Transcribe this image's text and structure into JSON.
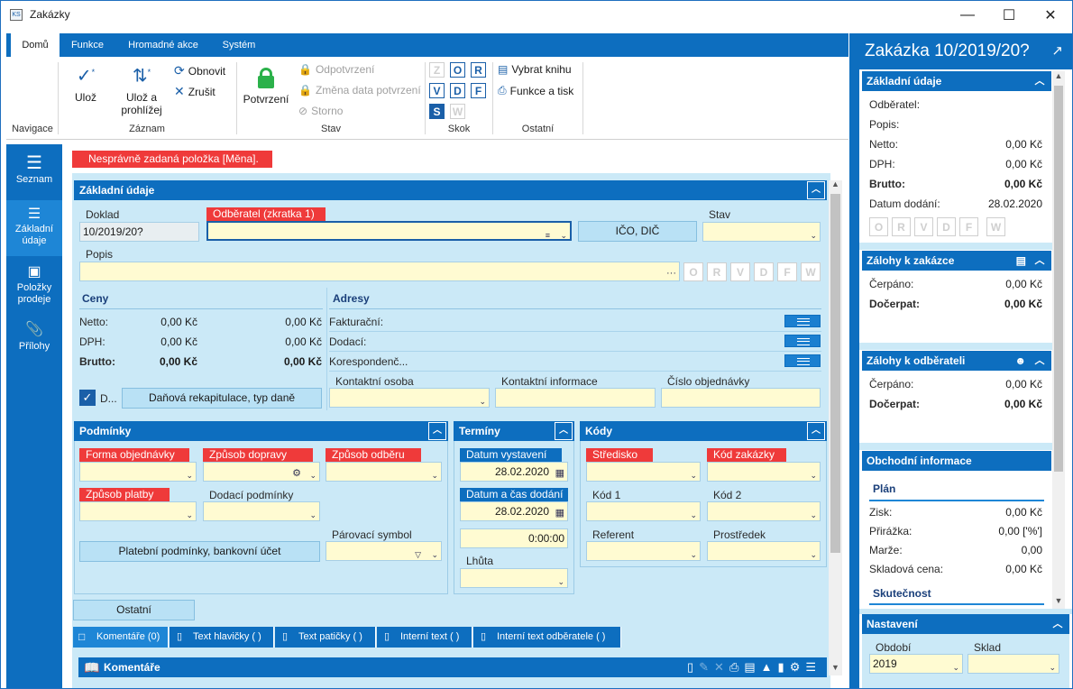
{
  "window": {
    "title": "Zakázky"
  },
  "ribbon": {
    "tabs": [
      {
        "label": "Domů"
      },
      {
        "label": "Funkce"
      },
      {
        "label": "Hromadné akce"
      },
      {
        "label": "Systém"
      }
    ],
    "groups": {
      "nav": "Navigace",
      "record": "Záznam",
      "state": "Stav",
      "jump": "Skok",
      "other": "Ostatní"
    },
    "save": "Ulož",
    "save_browse_1": "Ulož a",
    "save_browse_2": "prohlížej",
    "refresh": "Obnovit",
    "cancel": "Zrušit",
    "confirm": "Potvrzení",
    "unconfirm": "Odpotvrzení",
    "change_date": "Změna data potvrzení",
    "storno": "Storno",
    "jump_letters": [
      "Z",
      "O",
      "R",
      "V",
      "D",
      "F",
      "S",
      "W"
    ],
    "pick_book": "Vybrat knihu",
    "func_print": "Funkce a tisk"
  },
  "leftnav": {
    "items": [
      {
        "label": "Seznam"
      },
      {
        "label1": "Základní",
        "label2": "údaje"
      },
      {
        "label1": "Položky",
        "label2": "prodeje"
      },
      {
        "label": "Přílohy"
      }
    ]
  },
  "error": "Nesprávně zadaná položka [Měna].",
  "basic": {
    "title": "Základní údaje",
    "doklad_label": "Doklad",
    "doklad_value": "10/2019/20?",
    "customer_label": "Odběratel (zkratka 1)",
    "ico_button": "IČO, DIČ",
    "stav_label": "Stav",
    "popis_label": "Popis",
    "popis_dots": "···",
    "prices": {
      "title": "Ceny",
      "netto_label": "Netto:",
      "dph_label": "DPH:",
      "brutto_label": "Brutto:",
      "netto_1": "0,00 Kč",
      "netto_2": "0,00 Kč",
      "dph_1": "0,00 Kč",
      "dph_2": "0,00 Kč",
      "brutto_1": "0,00 Kč",
      "brutto_2": "0,00 Kč"
    },
    "checkbox_label": "D...",
    "tax_button": "Daňová rekapitulace, typ daně",
    "addresses": {
      "title": "Adresy",
      "billing": "Fakturační:",
      "delivery": "Dodací:",
      "correspondence": "Korespondenč..."
    },
    "contact_person": "Kontaktní osoba",
    "contact_info": "Kontaktní informace",
    "order_number": "Číslo objednávky"
  },
  "conditions": {
    "title": "Podmínky",
    "order_form": "Forma objednávky",
    "transport": "Způsob dopravy",
    "pickup": "Způsob odběru",
    "payment": "Způsob platby",
    "delivery_terms": "Dodací podmínky",
    "pairing": "Párovací symbol",
    "payment_button": "Platební podmínky, bankovní účet"
  },
  "terms": {
    "title": "Termíny",
    "issue_label": "Datum vystavení",
    "issue_value": "28.02.2020",
    "delivery_label": "Datum a čas dodání",
    "delivery_value": "28.02.2020",
    "time_value": "0:00:00",
    "deadline_label": "Lhůta"
  },
  "codes": {
    "title": "Kódy",
    "center": "Středisko",
    "order_code": "Kód zakázky",
    "code1": "Kód 1",
    "code2": "Kód 2",
    "referent": "Referent",
    "means": "Prostředek"
  },
  "other_button": "Ostatní",
  "bottom_tabs": [
    {
      "label": "Komentáře (0)"
    },
    {
      "label": "Text hlavičky ( )"
    },
    {
      "label": "Text patičky ( )"
    },
    {
      "label": "Interní text ( )"
    },
    {
      "label": "Interní text odběratele ( )"
    }
  ],
  "comments_title": "Komentáře",
  "right": {
    "title": "Zakázka 10/2019/20?",
    "basic": {
      "title": "Základní údaje",
      "customer": "Odběratel:",
      "desc": "Popis:",
      "netto": "Netto:",
      "netto_val": "0,00 Kč",
      "dph": "DPH:",
      "dph_val": "0,00 Kč",
      "brutto": "Brutto:",
      "brutto_val": "0,00 Kč",
      "delivery": "Datum dodání:",
      "delivery_val": "28.02.2020"
    },
    "jump_letters": [
      "O",
      "R",
      "V",
      "D",
      "F",
      "W"
    ],
    "adv_order": {
      "title": "Zálohy k zakázce",
      "used": "Čerpáno:",
      "used_val": "0,00 Kč",
      "rest": "Dočerpat:",
      "rest_val": "0,00 Kč"
    },
    "adv_cust": {
      "title": "Zálohy k odběrateli",
      "used": "Čerpáno:",
      "used_val": "0,00 Kč",
      "rest": "Dočerpat:",
      "rest_val": "0,00 Kč"
    },
    "business": {
      "title": "Obchodní informace",
      "plan": "Plán",
      "profit": "Zisk:",
      "profit_val": "0,00 Kč",
      "markup": "Přirážka:",
      "markup_val": "0,00 ['%']",
      "margin": "Marže:",
      "margin_val": "0,00",
      "stock_price": "Skladová cena:",
      "stock_price_val": "0,00 Kč",
      "actual": "Skutečnost"
    },
    "settings": {
      "title": "Nastavení",
      "period_label": "Období",
      "period_value": "2019",
      "store_label": "Sklad"
    }
  },
  "colors": {
    "accent": "#0d6ebf",
    "form_bg": "#cbe9f7",
    "required": "#ef3a3a",
    "input_bg": "#fffbd2"
  }
}
